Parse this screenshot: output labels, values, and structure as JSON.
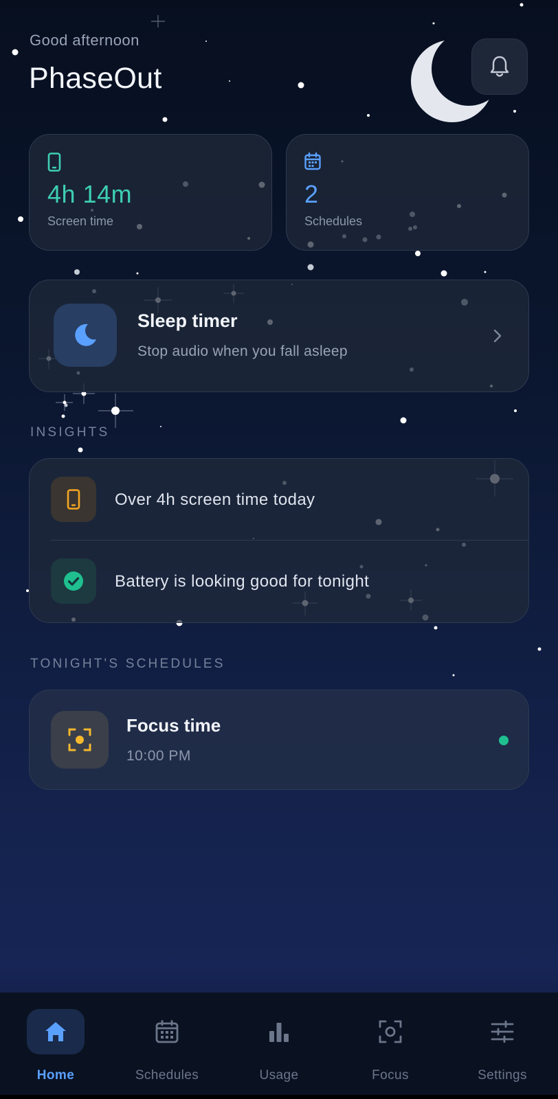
{
  "header": {
    "greeting": "Good afternoon",
    "title": "PhaseOut",
    "notification_icon": "bell-icon"
  },
  "stats": [
    {
      "value": "4h 14m",
      "label": "Screen time",
      "icon": "phone-icon",
      "color": "#3ecfb2"
    },
    {
      "value": "2",
      "label": "Schedules",
      "icon": "calendar-icon",
      "color": "#5aa0ff"
    }
  ],
  "sleep_timer": {
    "title": "Sleep timer",
    "subtitle": "Stop audio when you fall asleep",
    "icon": "moon-icon",
    "accent": "#5aa0ff"
  },
  "insights": {
    "heading": "INSIGHTS",
    "items": [
      {
        "text": "Over 4h screen time today",
        "icon": "phone-icon",
        "color": "#f5a623"
      },
      {
        "text": "Battery is looking good for tonight",
        "icon": "check-circle-icon",
        "color": "#1fbf8f"
      }
    ]
  },
  "schedules": {
    "heading": "TONIGHT'S SCHEDULES",
    "items": [
      {
        "title": "Focus time",
        "time": "10:00 PM",
        "icon": "focus-icon",
        "color": "#f5b82e",
        "status_color": "#1fbf8f"
      }
    ]
  },
  "nav": {
    "active": "Home",
    "active_color": "#5aa0ff",
    "items": [
      {
        "label": "Home",
        "icon": "home-icon"
      },
      {
        "label": "Schedules",
        "icon": "calendar-icon"
      },
      {
        "label": "Usage",
        "icon": "bar-chart-icon"
      },
      {
        "label": "Focus",
        "icon": "focus-icon"
      },
      {
        "label": "Settings",
        "icon": "sliders-icon"
      }
    ]
  }
}
